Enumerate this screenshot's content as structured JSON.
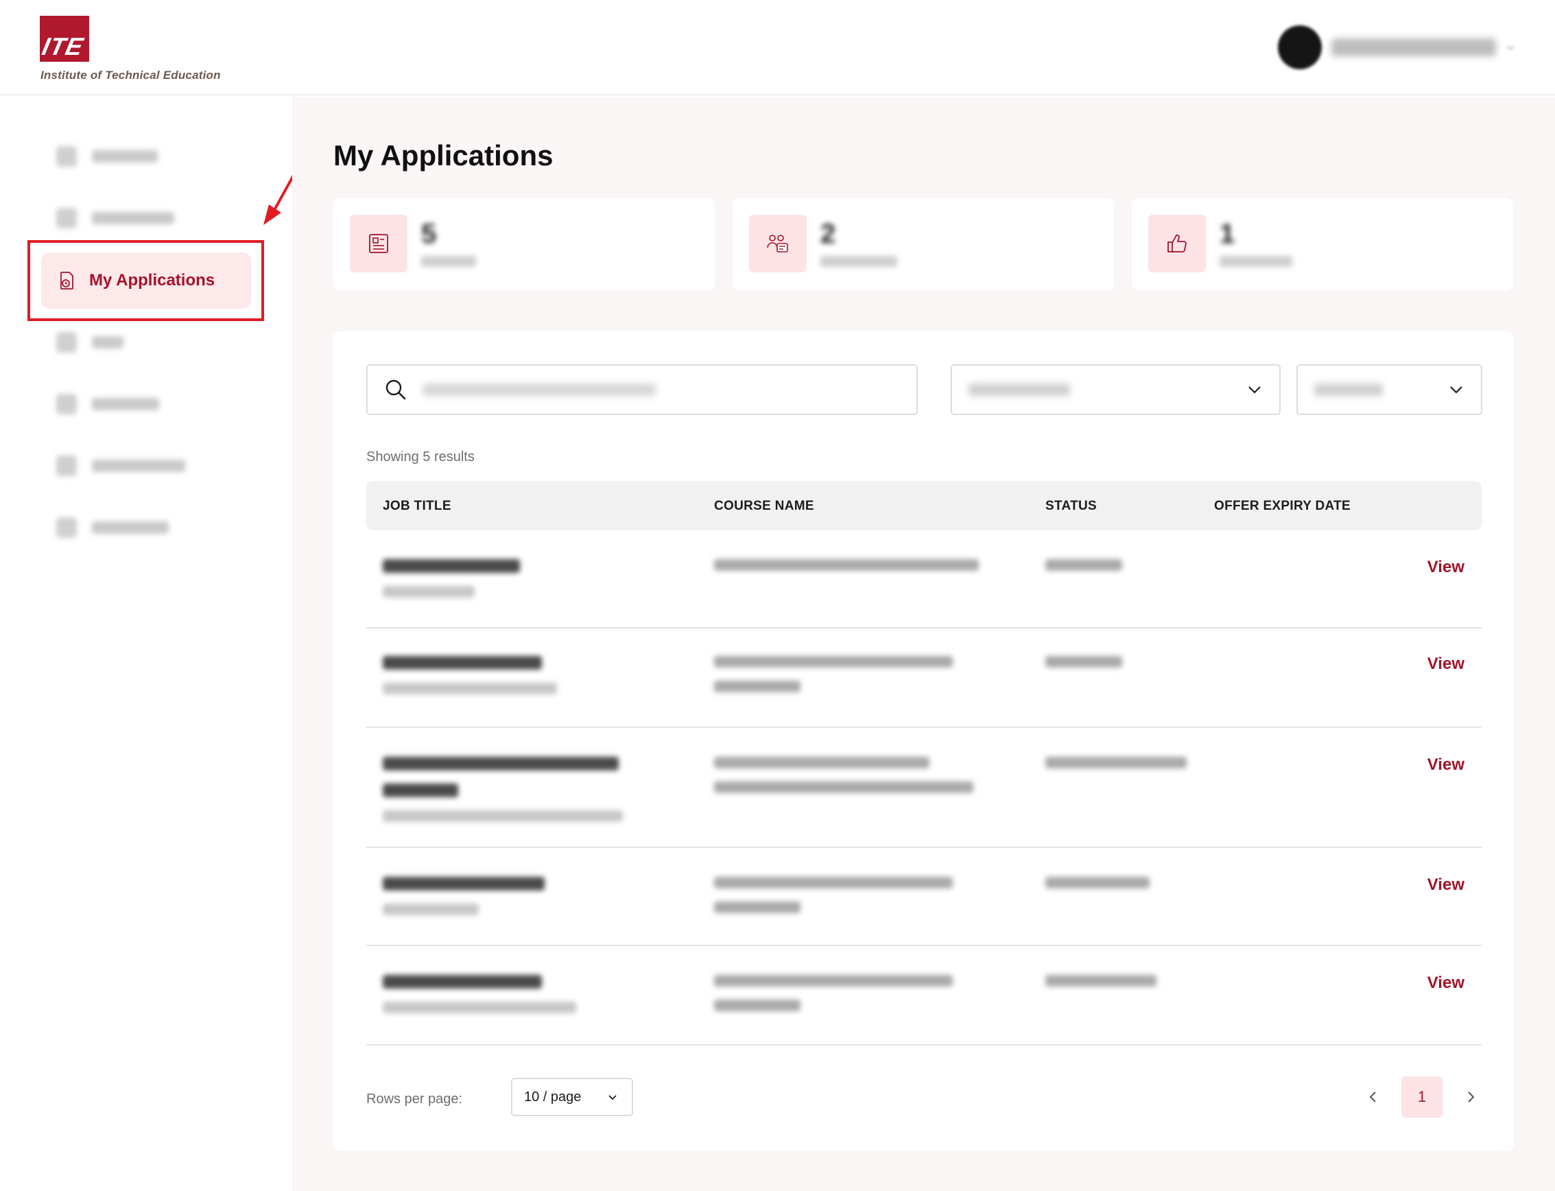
{
  "header": {
    "logo_letters": "ITE",
    "logo_text": "Institute of Technical Education"
  },
  "sidebar": {
    "active_item": "My Applications"
  },
  "main": {
    "page_title": "My Applications",
    "stats": [
      {
        "icon": "application-form-icon"
      },
      {
        "icon": "interview-chat-icon"
      },
      {
        "icon": "thumbs-up-icon"
      }
    ]
  },
  "table": {
    "results_text": "Showing 5 results",
    "columns": [
      "JOB TITLE",
      "COURSE NAME",
      "STATUS",
      "OFFER EXPIRY DATE"
    ],
    "view_label": "View",
    "row_count": 5
  },
  "footer": {
    "rows_per_page_label": "Rows per page:",
    "page_size_value": "10 / page",
    "current_page": "1"
  },
  "colors": {
    "brand": "#a3132a",
    "accent_bg": "#fde3e6",
    "highlight": "#e11d24"
  }
}
